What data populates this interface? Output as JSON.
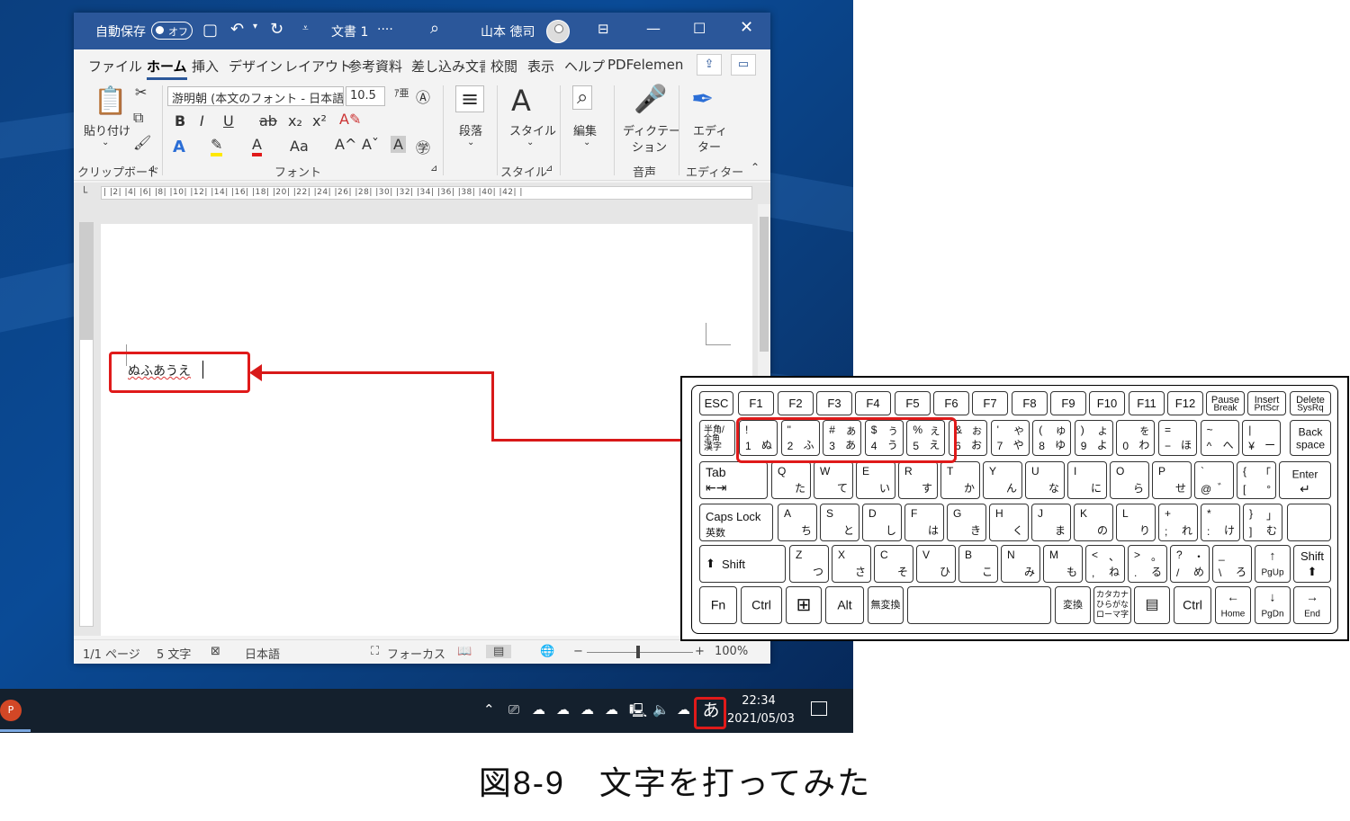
{
  "titlebar": {
    "autosave_label": "自動保存",
    "autosave_state": "オフ",
    "doc_title": "文書 1",
    "doc_title_suffix": "····",
    "user_name": "山本 徳司"
  },
  "menu": {
    "items": [
      "ファイル",
      "ホーム",
      "挿入",
      "デザイン",
      "レイアウト",
      "参考資料",
      "差し込み文書",
      "校閲",
      "表示",
      "ヘルプ",
      "PDFelement"
    ]
  },
  "ribbon": {
    "paste_label": "貼り付け",
    "clipboard_group": "クリップボード",
    "font_name": "游明朝 (本文のフォント - 日本語)",
    "font_size": "10.5",
    "font_group": "フォント",
    "paragraph_label": "段落",
    "style_label": "スタイル",
    "style_group": "スタイル",
    "edit_label": "編集",
    "dictation_label_1": "ディクテー",
    "dictation_label_2": "ション",
    "voice_group": "音声",
    "editor_label_1": "エディ",
    "editor_label_2": "ター",
    "editor_group": "エディター",
    "bold": "B",
    "italic": "I",
    "underline": "U",
    "strike": "ab",
    "subscript": "x₂",
    "superscript": "x²",
    "case": "Aa",
    "grow": "A^",
    "shrink": "Aˇ"
  },
  "ruler_text": "| |2| |4| |6| |8| |10| |12| |14| |16| |18| |20| |22| |24| |26| |28| |30| |32| |34| |36| |38| |40| |42| |",
  "document": {
    "typed_text": "ぬふあうえ"
  },
  "status": {
    "page": "1/1 ページ",
    "words": "5 文字",
    "language": "日本語",
    "focus": "フォーカス",
    "zoom_minus": "−",
    "zoom_plus": "+",
    "zoom": "100%"
  },
  "taskbar": {
    "pp_letter": "P",
    "ime": "あ",
    "time": "22:34",
    "date": "2021/05/03"
  },
  "keyboard": {
    "fkeys": [
      "ESC",
      "F1",
      "F2",
      "F3",
      "F4",
      "F5",
      "F6",
      "F7",
      "F8",
      "F9",
      "F10",
      "F11",
      "F12"
    ],
    "pause_1": "Pause",
    "pause_2": "Break",
    "insert_1": "Insert",
    "insert_2": "PrtScr",
    "delete_1": "Delete",
    "delete_2": "SysRq",
    "hankaku_1": "半角/",
    "hankaku_2": "全角",
    "hankaku_3": "漢字",
    "num_row": [
      {
        "a": "!",
        "b": "",
        "c": "1",
        "d": "ぬ"
      },
      {
        "a": "\"",
        "b": "",
        "c": "2",
        "d": "ふ"
      },
      {
        "a": "#",
        "b": "あ",
        "c": "3",
        "d": "あ"
      },
      {
        "a": "$",
        "b": "う",
        "c": "4",
        "d": "う"
      },
      {
        "a": "%",
        "b": "え",
        "c": "5",
        "d": "え"
      },
      {
        "a": "&",
        "b": "お",
        "c": "6",
        "d": "お"
      },
      {
        "a": "'",
        "b": "や",
        "c": "7",
        "d": "や"
      },
      {
        "a": "(",
        "b": "ゆ",
        "c": "8",
        "d": "ゆ"
      },
      {
        "a": ")",
        "b": "よ",
        "c": "9",
        "d": "よ"
      },
      {
        "a": "",
        "b": "を",
        "c": "0",
        "d": "わ"
      },
      {
        "a": "=",
        "b": "",
        "c": "−",
        "d": "ほ"
      },
      {
        "a": "~",
        "b": "",
        "c": "^",
        "d": "へ"
      },
      {
        "a": "|",
        "b": "",
        "c": "¥",
        "d": "ー"
      }
    ],
    "backspace_1": "Back",
    "backspace_2": "space",
    "tab": "Tab",
    "q_row": [
      {
        "a": "Q",
        "b": "た"
      },
      {
        "a": "W",
        "b": "て"
      },
      {
        "a": "E",
        "b": "い"
      },
      {
        "a": "R",
        "b": "す"
      },
      {
        "a": "T",
        "b": "か"
      },
      {
        "a": "Y",
        "b": "ん"
      },
      {
        "a": "U",
        "b": "な"
      },
      {
        "a": "I",
        "b": "に"
      },
      {
        "a": "O",
        "b": "ら"
      },
      {
        "a": "P",
        "b": "せ"
      },
      {
        "a": "`",
        "b": "゛",
        "c": "@"
      },
      {
        "a": "{",
        "b": "°",
        "c": "[",
        "d": "「"
      }
    ],
    "enter": "Enter",
    "caps_1": "Caps Lock",
    "caps_2": "英数",
    "a_row": [
      {
        "a": "A",
        "b": "ち"
      },
      {
        "a": "S",
        "b": "と"
      },
      {
        "a": "D",
        "b": "し"
      },
      {
        "a": "F",
        "b": "は"
      },
      {
        "a": "G",
        "b": "き"
      },
      {
        "a": "H",
        "b": "く"
      },
      {
        "a": "J",
        "b": "ま"
      },
      {
        "a": "K",
        "b": "の"
      },
      {
        "a": "L",
        "b": "り"
      },
      {
        "a": "+",
        "b": "れ",
        "c": ";"
      },
      {
        "a": "*",
        "b": "け",
        "c": ":"
      },
      {
        "a": "}",
        "b": "む",
        "c": "]",
        "d": "」"
      }
    ],
    "shift": "Shift",
    "z_row": [
      {
        "a": "Z",
        "b": "つ"
      },
      {
        "a": "X",
        "b": "さ"
      },
      {
        "a": "C",
        "b": "そ"
      },
      {
        "a": "V",
        "b": "ひ"
      },
      {
        "a": "B",
        "b": "こ"
      },
      {
        "a": "N",
        "b": "み"
      },
      {
        "a": "M",
        "b": "も"
      },
      {
        "a": "<",
        "b": "ね",
        "c": ",",
        "d": "、"
      },
      {
        "a": ">",
        "b": "る",
        "c": ".",
        "d": "。"
      },
      {
        "a": "?",
        "b": "め",
        "c": "/",
        "d": "・"
      },
      {
        "a": "_",
        "b": "ろ",
        "c": "\\"
      }
    ],
    "pgup": "PgUp",
    "fn": "Fn",
    "ctrl": "Ctrl",
    "alt": "Alt",
    "muhenkan": "無変換",
    "henkan": "変換",
    "kana_1": "カタカナ",
    "kana_2": "ひらがな",
    "kana_3": "ローマ字",
    "home": "Home",
    "pgdn": "PgDn",
    "end": "End"
  },
  "caption": "図8-9　文字を打ってみた"
}
